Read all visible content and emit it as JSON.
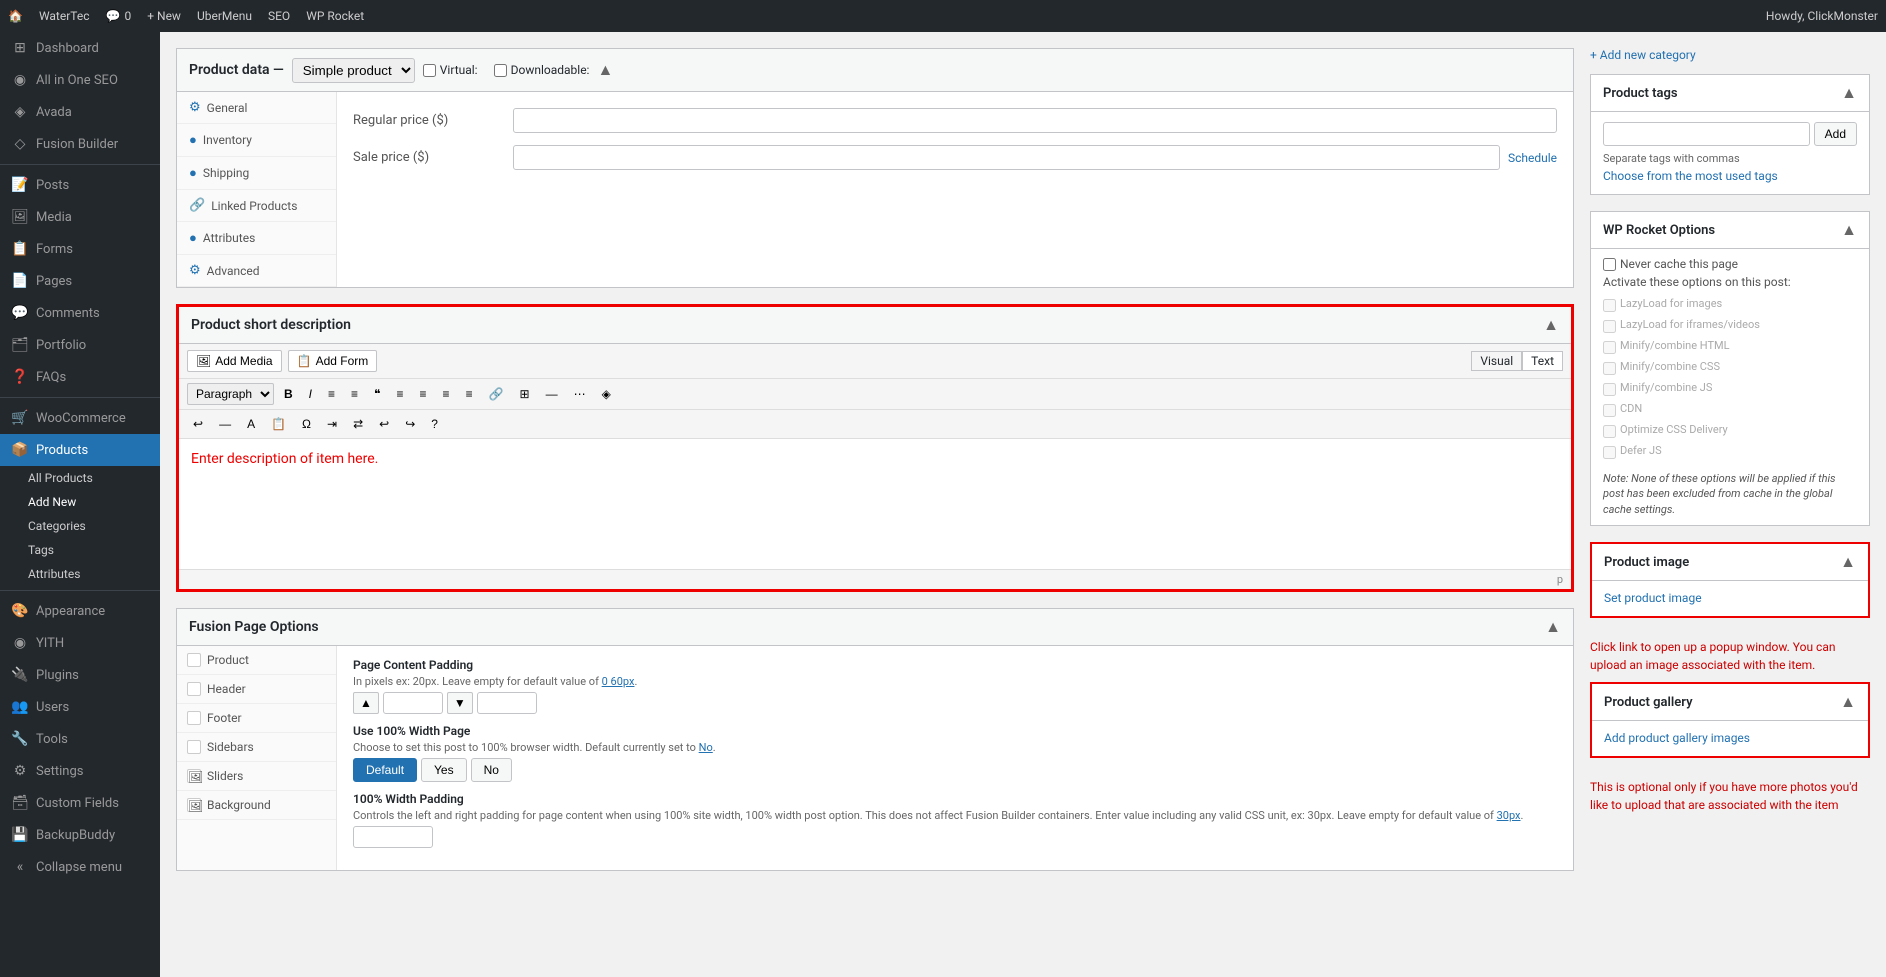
{
  "adminbar": {
    "site_icon": "🏠",
    "site_name": "WaterTec",
    "updates_count": "0",
    "new_label": "+ New",
    "ubermenu_label": "UberMenu",
    "seo_label": "SEO",
    "wprocket_label": "WP Rocket",
    "howdy": "Howdy, ClickMonster"
  },
  "sidebar": {
    "items": [
      {
        "id": "dashboard",
        "label": "Dashboard",
        "icon": "⊞"
      },
      {
        "id": "allinone-seo",
        "label": "All in One SEO",
        "icon": "◉"
      },
      {
        "id": "avada",
        "label": "Avada",
        "icon": "◈"
      },
      {
        "id": "fusion-builder",
        "label": "Fusion Builder",
        "icon": "◇"
      },
      {
        "id": "posts",
        "label": "Posts",
        "icon": "📝"
      },
      {
        "id": "media",
        "label": "Media",
        "icon": "🖼"
      },
      {
        "id": "forms",
        "label": "Forms",
        "icon": "📋"
      },
      {
        "id": "pages",
        "label": "Pages",
        "icon": "📄"
      },
      {
        "id": "comments",
        "label": "Comments",
        "icon": "💬"
      },
      {
        "id": "portfolio",
        "label": "Portfolio",
        "icon": "🗂"
      },
      {
        "id": "faqs",
        "label": "FAQs",
        "icon": "❓"
      },
      {
        "id": "woocommerce",
        "label": "WooCommerce",
        "icon": "🛒"
      },
      {
        "id": "products",
        "label": "Products",
        "icon": "📦",
        "active": true
      }
    ],
    "submenu": [
      {
        "id": "all-products",
        "label": "All Products"
      },
      {
        "id": "add-new",
        "label": "Add New",
        "active": true
      },
      {
        "id": "categories",
        "label": "Categories"
      },
      {
        "id": "tags",
        "label": "Tags"
      },
      {
        "id": "attributes",
        "label": "Attributes"
      }
    ],
    "bottom_items": [
      {
        "id": "appearance",
        "label": "Appearance",
        "icon": "🎨"
      },
      {
        "id": "yith",
        "label": "YITH",
        "icon": "◉"
      },
      {
        "id": "plugins",
        "label": "Plugins",
        "icon": "🔌"
      },
      {
        "id": "users",
        "label": "Users",
        "icon": "👥"
      },
      {
        "id": "tools",
        "label": "Tools",
        "icon": "🔧"
      },
      {
        "id": "settings",
        "label": "Settings",
        "icon": "⚙"
      },
      {
        "id": "custom-fields",
        "label": "Custom Fields",
        "icon": "🗃"
      },
      {
        "id": "backupbuddy",
        "label": "BackupBuddy",
        "icon": "💾"
      },
      {
        "id": "collapse",
        "label": "Collapse menu",
        "icon": "«"
      }
    ]
  },
  "product_data": {
    "title": "Product data",
    "separator": "—",
    "type_label": "Simple product",
    "virtual_label": "Virtual:",
    "downloadable_label": "Downloadable:",
    "tabs": [
      {
        "id": "general",
        "label": "General",
        "icon": "⚙"
      },
      {
        "id": "inventory",
        "label": "Inventory",
        "icon": "🔵"
      },
      {
        "id": "shipping",
        "label": "Shipping",
        "icon": "🔵"
      },
      {
        "id": "linked-products",
        "label": "Linked Products",
        "icon": "🔗"
      },
      {
        "id": "attributes",
        "label": "Attributes",
        "icon": "🔵"
      },
      {
        "id": "advanced",
        "label": "Advanced",
        "icon": "⚙"
      }
    ],
    "general": {
      "regular_price_label": "Regular price ($)",
      "sale_price_label": "Sale price ($)",
      "schedule_link": "Schedule"
    }
  },
  "short_description": {
    "title": "Product short description",
    "add_media_btn": "Add Media",
    "add_form_btn": "Add Form",
    "visual_tab": "Visual",
    "text_tab": "Text",
    "format_options": [
      "Paragraph"
    ],
    "toolbar_buttons": [
      "B",
      "I",
      "≡",
      "≡",
      "❝",
      "≡",
      "≡",
      "≡",
      "≡",
      "🔗",
      "≡",
      "≡",
      "≡",
      "≡"
    ],
    "placeholder": "Enter description of item here.",
    "annotation": "Click link to open up a popup window. You can upload an image associated with the item."
  },
  "fusion_page_options": {
    "title": "Fusion Page Options",
    "tabs": [
      {
        "id": "product",
        "label": "Product"
      },
      {
        "id": "header",
        "label": "Header"
      },
      {
        "id": "footer",
        "label": "Footer"
      },
      {
        "id": "sidebars",
        "label": "Sidebars"
      },
      {
        "id": "sliders",
        "label": "Sliders"
      },
      {
        "id": "background",
        "label": "Background"
      }
    ],
    "fields": {
      "page_content_padding": {
        "label": "Page Content Padding",
        "hint": "In pixels ex: 20px. Leave empty for default value of 0 60px.",
        "hint_link": "0 60px"
      },
      "use_100_width": {
        "label": "Use 100% Width Page",
        "hint": "Choose to set this post to 100% browser width. Default currently set to No.",
        "hint_link": "No",
        "btn_default": "Default",
        "btn_yes": "Yes",
        "btn_no": "No"
      },
      "width_100_padding": {
        "label": "100% Width Padding",
        "hint": "Controls the left and right padding for page content when using 100% site width, 100% width post option. This does not affect Fusion Builder containers. Enter value including any valid CSS unit, ex: 30px. Leave empty for default value of 30px.",
        "hint_link": "30px"
      }
    }
  },
  "sidebar_right": {
    "add_category_link": "+ Add new category",
    "product_tags": {
      "title": "Product tags",
      "add_btn": "Add",
      "separate_hint": "Separate tags with commas",
      "choose_link": "Choose from the most used tags"
    },
    "wp_rocket": {
      "title": "WP Rocket Options",
      "never_cache_label": "Never cache this page",
      "activate_label": "Activate these options on this post:",
      "options": [
        {
          "id": "lazyload-images",
          "label": "LazyLoad for images"
        },
        {
          "id": "lazyload-iframes",
          "label": "LazyLoad for iframes/videos"
        },
        {
          "id": "minify-html",
          "label": "Minify/combine HTML"
        },
        {
          "id": "minify-css",
          "label": "Minify/combine CSS"
        },
        {
          "id": "minify-js",
          "label": "Minify/combine JS"
        },
        {
          "id": "cdn",
          "label": "CDN"
        },
        {
          "id": "optimize-css",
          "label": "Optimize CSS Delivery"
        },
        {
          "id": "defer-js",
          "label": "Defer JS"
        }
      ],
      "note": "Note: None of these options will be applied if this post has been excluded from cache in the global cache settings."
    },
    "product_image": {
      "title": "Product image",
      "set_link": "Set product image"
    },
    "product_gallery": {
      "title": "Product gallery",
      "add_link": "Add product gallery images",
      "annotation": "This is optional only if you have more photos you'd like to upload that are associated with the item"
    }
  },
  "colors": {
    "accent_blue": "#2271b1",
    "red_annotation": "#cc0000",
    "active_menu_bg": "#2271b1",
    "admin_bar_bg": "#23282d",
    "sidebar_bg": "#23282d",
    "border": "#c3c4c7"
  }
}
